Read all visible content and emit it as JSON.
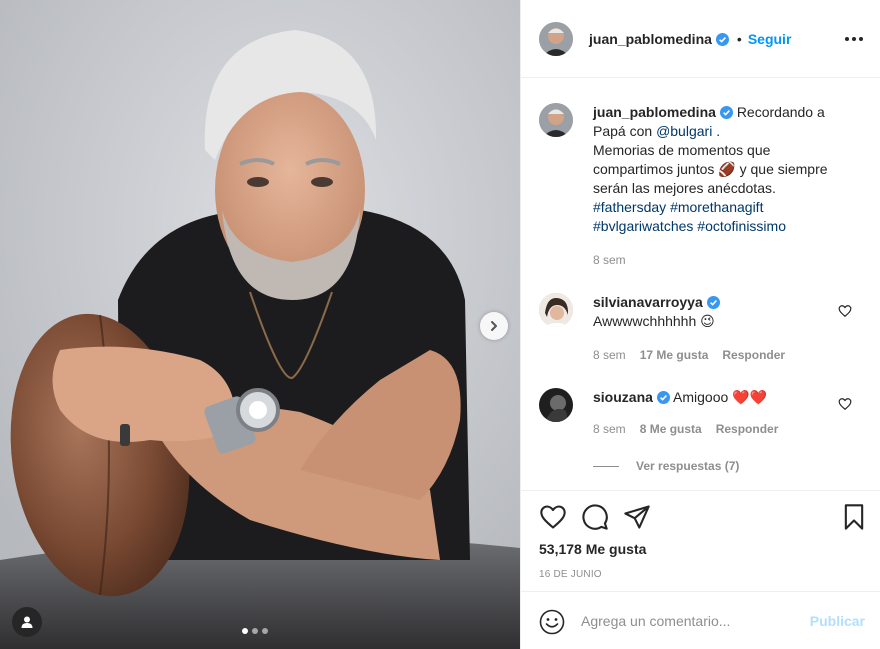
{
  "post": {
    "author": {
      "username": "juan_pablomedina",
      "verified": true,
      "follow_label": "Seguir",
      "separator": "•"
    },
    "caption": {
      "username": "juan_pablomedina",
      "text_1": "Recordando a Papá con",
      "mention": "@bulgari",
      "text_2": ".",
      "text_3": "Memorias de momentos que compartimos juntos",
      "emoji": "🏈",
      "text_4": "y que siempre serán las mejores anécdotas.",
      "hashtags": [
        "#fathersday",
        "#morethanagift",
        "#bvlgariwatches",
        "#octofinissimo"
      ],
      "time": "8 sem"
    },
    "comments": [
      {
        "username": "silvianavarroyya",
        "verified": true,
        "text": "Awwwwchhhhhh",
        "emoji": "😉",
        "time": "8 sem",
        "likes": "17 Me gusta",
        "reply_label": "Responder"
      },
      {
        "username": "siouzana",
        "verified": true,
        "text": "Amigooo",
        "emoji": "❤️❤️",
        "time": "8 sem",
        "likes": "8 Me gusta",
        "reply_label": "Responder",
        "view_replies": "Ver respuestas (7)"
      }
    ],
    "likes_count": "53,178 Me gusta",
    "date": "16 DE JUNIO",
    "comment_box": {
      "placeholder": "Agrega un comentario...",
      "publish_label": "Publicar"
    },
    "carousel": {
      "count": 3,
      "active": 1
    },
    "icons": {
      "like": "heart-icon",
      "comment": "comment-icon",
      "share": "send-icon",
      "save": "bookmark-icon",
      "emoji": "emoji-icon",
      "more": "more-options-icon",
      "next": "chevron-right-icon",
      "tags": "user-tag-icon",
      "verified": "verified-badge-icon"
    },
    "colors": {
      "link_blue": "#0095f6",
      "hashtag_blue": "#00376b",
      "secondary_text": "#8e8e8e",
      "publish_disabled": "#b2dffc",
      "heart_red": "#ed4956"
    }
  }
}
